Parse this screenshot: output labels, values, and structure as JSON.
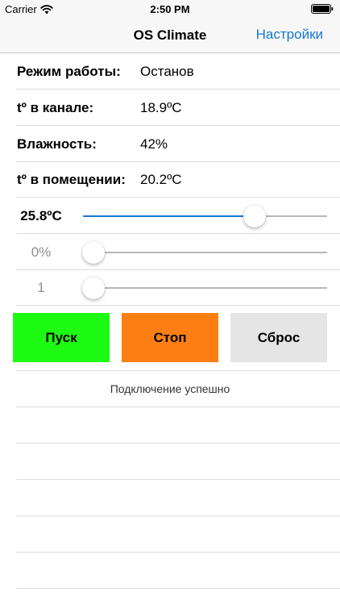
{
  "status_bar": {
    "carrier": "Carrier",
    "time": "2:50 PM",
    "wifi_icon": "wifi-icon",
    "battery_icon": "battery-full-icon"
  },
  "nav": {
    "title": "OS Climate",
    "settings_label": "Настройки"
  },
  "info": {
    "mode_label": "Режим работы:",
    "mode_value": "Останов",
    "channel_temp_label": "tº в канале:",
    "channel_temp_value": "18.9ºC",
    "humidity_label": "Влажность:",
    "humidity_value": "42%",
    "room_temp_label": "tº в помещении:",
    "room_temp_value": "20.2ºC"
  },
  "sliders": {
    "temperature": {
      "label": "25.8ºC",
      "fraction": 0.703
    },
    "humidity": {
      "label": "0%",
      "fraction": 0.043
    },
    "fan": {
      "label": "1",
      "fraction": 0.043
    }
  },
  "buttons": {
    "start_label": "Пуск",
    "stop_label": "Стоп",
    "reset_label": "Сброс"
  },
  "colors": {
    "accent": "#1577d6",
    "start": "#1efb12",
    "stop": "#fd7f14",
    "reset": "#e5e5e5"
  },
  "connection_status": "Подключение успешно"
}
